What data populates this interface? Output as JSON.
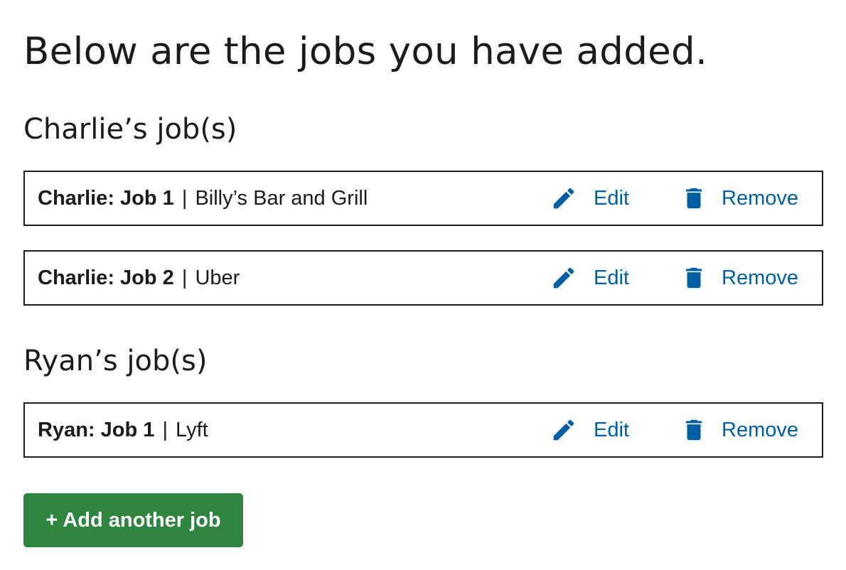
{
  "page": {
    "title": "Below are the jobs you have added."
  },
  "people": [
    {
      "heading": "Charlie’s job(s)",
      "jobs": [
        {
          "id_label": "Charlie: Job 1",
          "separator": "|",
          "employer": "Billy’s Bar and Grill",
          "edit_label": "Edit",
          "remove_label": "Remove"
        },
        {
          "id_label": "Charlie: Job 2",
          "separator": "|",
          "employer": "Uber",
          "edit_label": "Edit",
          "remove_label": "Remove"
        }
      ]
    },
    {
      "heading": "Ryan’s job(s)",
      "jobs": [
        {
          "id_label": "Ryan: Job 1",
          "separator": "|",
          "employer": "Lyft",
          "edit_label": "Edit",
          "remove_label": "Remove"
        }
      ]
    }
  ],
  "add_button": {
    "label": "+ Add another job"
  },
  "icons": {
    "edit": "pencil-icon",
    "remove": "trash-icon"
  },
  "colors": {
    "link": "#005ea2",
    "primary_button": "#2e8540",
    "border": "#1b1b1b",
    "text": "#1b1b1b"
  }
}
